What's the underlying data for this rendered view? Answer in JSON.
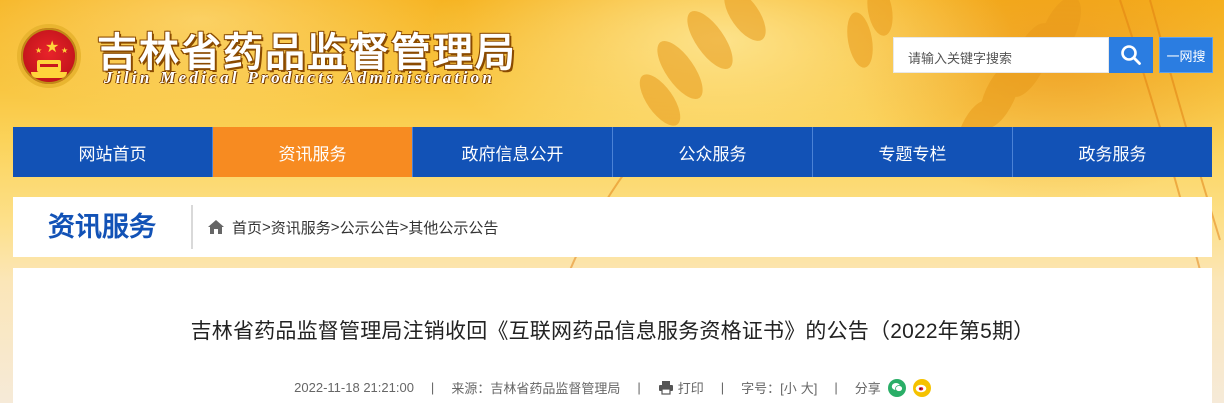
{
  "header": {
    "site_title": "吉林省药品监督管理局",
    "site_subtitle": "Jilin Medical Products Administration",
    "search_placeholder": "请输入关键字搜索",
    "search_icon": "search-icon",
    "yiwang_label": "一网搜"
  },
  "nav": {
    "items": [
      {
        "label": "网站首页"
      },
      {
        "label": "资讯服务"
      },
      {
        "label": "政府信息公开"
      },
      {
        "label": "公众服务"
      },
      {
        "label": "专题专栏"
      },
      {
        "label": "政务服务"
      }
    ],
    "active_index": 1
  },
  "section": {
    "title": "资讯服务",
    "breadcrumb": [
      "首页",
      "资讯服务",
      "公示公告",
      "其他公示公告"
    ],
    "separator": ">"
  },
  "article": {
    "title": "吉林省药品监督管理局注销收回《互联网药品信息服务资格证书》的公告（2022年第5期）",
    "date": "2022-11-18 21:21:00",
    "source_label": "来源：",
    "source": "吉林省药品监督管理局",
    "print_label": "打印",
    "font_label": "字号：",
    "font_small": "[小",
    "font_large": "大]",
    "share_label": "分享",
    "divider": "|"
  },
  "colors": {
    "nav_blue": "#1252b6",
    "nav_active": "#f78b21",
    "search_blue": "#2b7de1"
  }
}
